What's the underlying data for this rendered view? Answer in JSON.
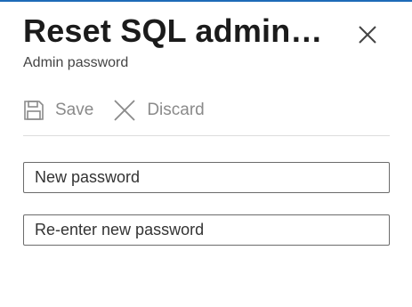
{
  "panel": {
    "title": "Reset SQL admin p...",
    "subtitle": "Admin password",
    "close_icon": "close-icon"
  },
  "toolbar": {
    "save_label": "Save",
    "save_icon": "save-icon",
    "discard_label": "Discard",
    "discard_icon": "discard-icon"
  },
  "form": {
    "new_password": {
      "placeholder": "New password",
      "value": ""
    },
    "confirm_password": {
      "placeholder": "Re-enter new password",
      "value": ""
    }
  },
  "colors": {
    "accent": "#1e6bb8",
    "disabled_text": "#8a8a8a",
    "title_text": "#1b1b1b"
  }
}
